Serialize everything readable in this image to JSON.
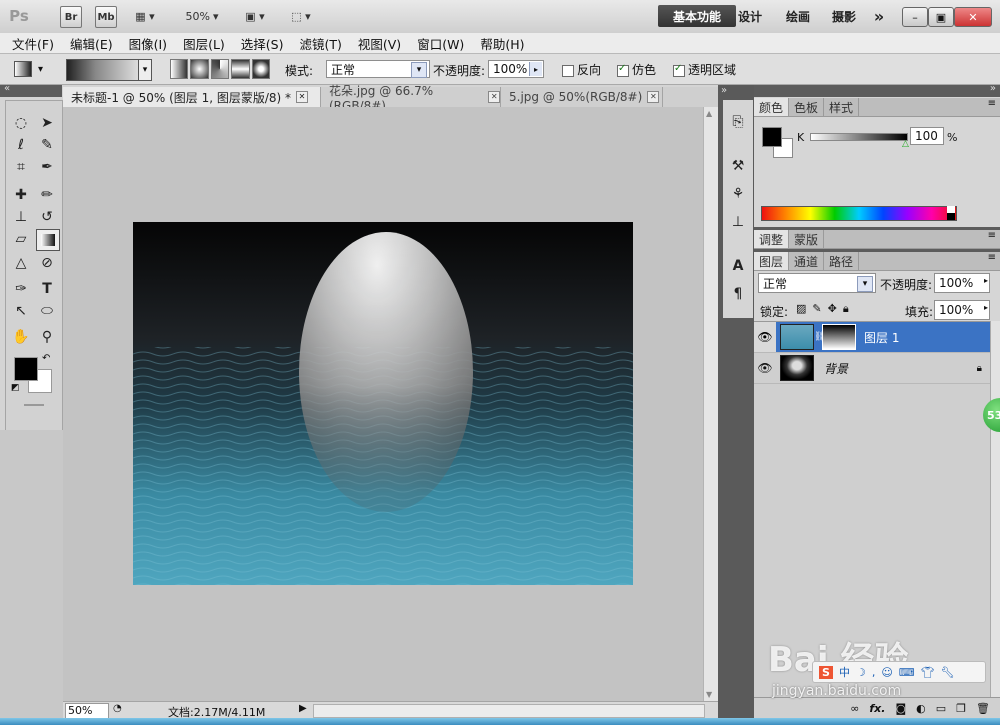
{
  "app": {
    "logo": "Ps",
    "bridge_label": "Br",
    "minibridge_label": "Mb",
    "zoom_value": "50%",
    "workspaces": [
      "基本功能",
      "设计",
      "绘画",
      "摄影"
    ],
    "more_label": "»",
    "win_buttons": [
      "–",
      "▣",
      "✕"
    ]
  },
  "menu": [
    "文件(F)",
    "编辑(E)",
    "图像(I)",
    "图层(L)",
    "选择(S)",
    "滤镜(T)",
    "视图(V)",
    "窗口(W)",
    "帮助(H)"
  ],
  "options": {
    "mode_label": "模式:",
    "mode_value": "正常",
    "opacity_label": "不透明度:",
    "opacity_value": "100%",
    "reverse_label": "反向",
    "dither_label": "仿色",
    "transparency_label": "透明区域",
    "reverse_checked": false,
    "dither_checked": true,
    "transparency_checked": true
  },
  "documents": {
    "tabs": [
      "未标题-1 @ 50% (图层 1, 图层蒙版/8) *",
      "花朵.jpg @ 66.7%(RGB/8#)",
      "5.jpg @ 50%(RGB/8#)"
    ],
    "status_zoom": "50%",
    "status_doc": "文档:2.17M/4.11M"
  },
  "color_panel": {
    "tabs": [
      "颜色",
      "色板",
      "样式"
    ],
    "channel_label": "K",
    "value": "100",
    "unit": "%"
  },
  "adjust_panel": {
    "tabs": [
      "调整",
      "蒙版"
    ]
  },
  "layers_panel": {
    "tabs": [
      "图层",
      "通道",
      "路径"
    ],
    "blend_mode": "正常",
    "opacity_label": "不透明度:",
    "opacity_value": "100%",
    "lock_label": "锁定:",
    "fill_label": "填充:",
    "fill_value": "100%",
    "layers": [
      {
        "name": "图层 1",
        "selected": true
      },
      {
        "name": "背景",
        "selected": false
      }
    ],
    "bottom_icons": [
      "link-icon",
      "fx-icon",
      "mask-icon",
      "adjustment-icon",
      "folder-icon",
      "new-layer-icon",
      "trash-icon"
    ],
    "fx_label": "fx."
  },
  "badge": "53",
  "watermark": {
    "brand": "Bai 经验",
    "url": "jingyan.baidu.com"
  },
  "colors": {
    "selection_blue": "#3b73c4",
    "ps_dark": "#5a5a5a"
  }
}
